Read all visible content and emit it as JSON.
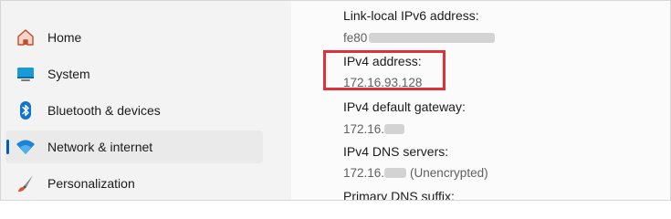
{
  "sidebar": {
    "items": [
      {
        "label": "Home",
        "icon": "home-icon"
      },
      {
        "label": "System",
        "icon": "system-monitor-icon"
      },
      {
        "label": "Bluetooth & devices",
        "icon": "bluetooth-icon"
      },
      {
        "label": "Network & internet",
        "icon": "wifi-icon",
        "selected": true
      },
      {
        "label": "Personalization",
        "icon": "paintbrush-icon"
      }
    ]
  },
  "properties": {
    "ipv6_label": "Link-local IPv6 address:",
    "ipv6_value_visible": "fe80",
    "ipv4_label": "IPv4 address:",
    "ipv4_value": "172.16.93.128",
    "gateway_label": "IPv4 default gateway:",
    "gateway_value_visible": "172.16.",
    "dns_label": "IPv4 DNS servers:",
    "dns_value_visible": "172.16.",
    "dns_note": "(Unencrypted)",
    "suffix_label": "Primary DNS suffix:"
  },
  "colors": {
    "accent": "#005fb8",
    "highlight_box": "#e0303a"
  }
}
